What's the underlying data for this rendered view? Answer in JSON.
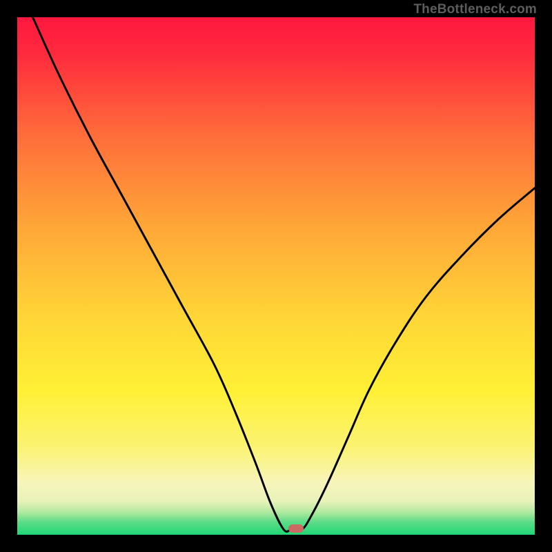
{
  "watermark": "TheBottleneck.com",
  "chart_data": {
    "type": "line",
    "title": "",
    "xlabel": "",
    "ylabel": "",
    "xlim": [
      0,
      100
    ],
    "ylim": [
      0,
      100
    ],
    "grid": false,
    "series": [
      {
        "name": "bottleneck-curve",
        "x": [
          3,
          8,
          14,
          20,
          26,
          32,
          38,
          42,
          46,
          49,
          51.5,
          53,
          55,
          57,
          60,
          64,
          68,
          73,
          79,
          86,
          93,
          100
        ],
        "y": [
          100,
          89,
          77,
          66,
          55,
          44,
          33,
          24,
          14,
          6,
          1,
          1,
          1,
          4,
          10,
          19,
          28,
          37,
          46,
          54,
          61,
          67
        ]
      }
    ],
    "marker": {
      "x": 53.8,
      "y": 1.2,
      "color": "#cb6a63"
    },
    "background_gradient": {
      "top": "#ff173e",
      "mid_upper": "#ff8a3a",
      "mid": "#ffe638",
      "mid_lower": "#faf6a8",
      "bottom": "#1fd677"
    }
  }
}
